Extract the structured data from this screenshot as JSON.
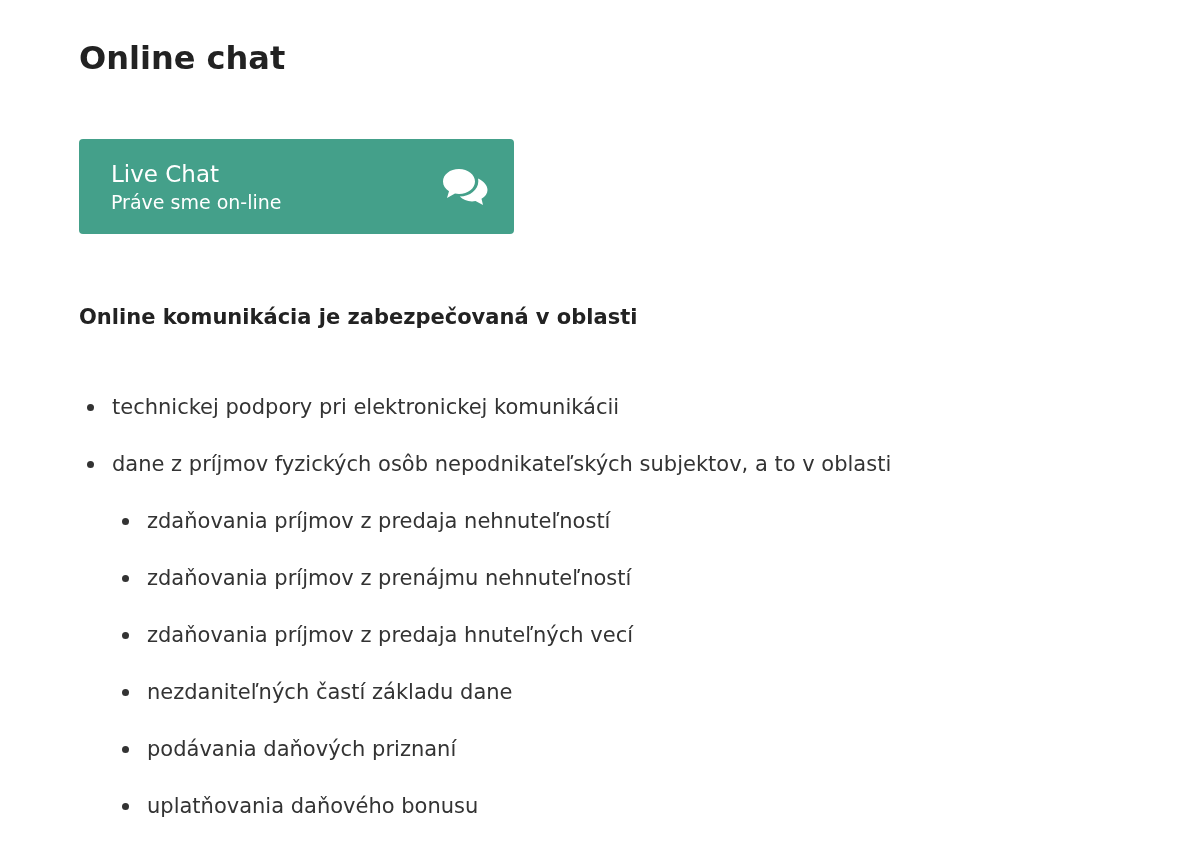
{
  "title": "Online chat",
  "chat_button": {
    "label": "Live Chat",
    "status": "Práve sme on-line"
  },
  "section_heading": "Online komunikácia je zabezpečovaná v oblasti",
  "list": [
    {
      "text": "technickej podpory pri elektronickej komunikácii"
    },
    {
      "text": "dane z príjmov fyzických osôb nepodnikateľských subjektov, a to v oblasti",
      "children": [
        {
          "text": "zdaňovania príjmov z predaja nehnuteľností"
        },
        {
          "text": "zdaňovania príjmov z prenájmu nehnuteľností"
        },
        {
          "text": "zdaňovania príjmov z predaja hnuteľných vecí"
        },
        {
          "text": "nezdaniteľných častí základu dane"
        },
        {
          "text": "podávania daňových priznaní"
        },
        {
          "text": "uplatňovania daňového bonusu"
        }
      ]
    }
  ]
}
